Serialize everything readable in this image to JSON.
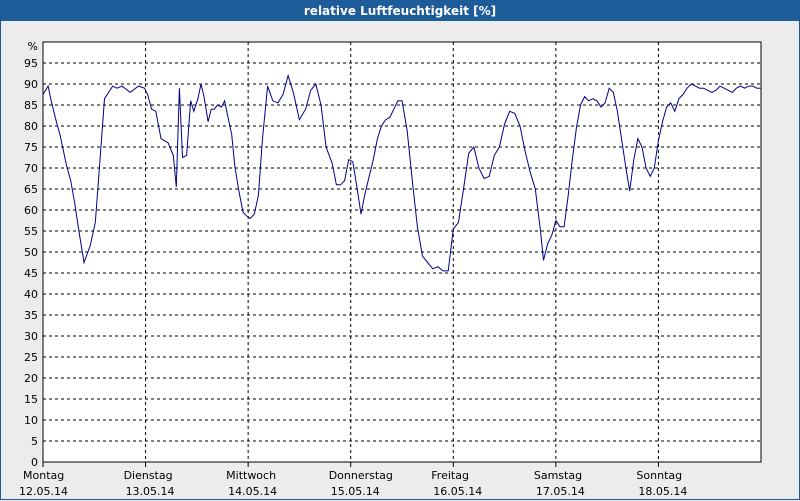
{
  "window": {
    "title": "relative Luftfeuchtigkeit [%]"
  },
  "colors": {
    "titlebar": "#1d5c99",
    "line": "#00008b",
    "grid": "#000000",
    "background": "#ececec"
  },
  "chart_data": {
    "type": "line",
    "title": "relative Luftfeuchtigkeit [%]",
    "ylabel": "%",
    "xlabel": "",
    "ylim": [
      0,
      95
    ],
    "xlim": [
      0,
      7
    ],
    "grid": true,
    "yticks": [
      0,
      5,
      10,
      15,
      20,
      25,
      30,
      35,
      40,
      45,
      50,
      55,
      60,
      65,
      70,
      75,
      80,
      85,
      90,
      95
    ],
    "xticks": [
      {
        "day": "Montag",
        "date": "12.05.14"
      },
      {
        "day": "Dienstag",
        "date": "13.05.14"
      },
      {
        "day": "Mittwoch",
        "date": "14.05.14"
      },
      {
        "day": "Donnerstag",
        "date": "15.05.14"
      },
      {
        "day": "Freitag",
        "date": "16.05.14"
      },
      {
        "day": "Samstag",
        "date": "17.05.14"
      },
      {
        "day": "Sonntag",
        "date": "18.05.14"
      }
    ],
    "series": [
      {
        "x": [
          0.0,
          0.05,
          0.08,
          0.12,
          0.17,
          0.23,
          0.27,
          0.31,
          0.35,
          0.4,
          0.46,
          0.51,
          0.55,
          0.6,
          0.64,
          0.68,
          0.72,
          0.77,
          0.85,
          0.93,
          0.99,
          1.02,
          1.06,
          1.1,
          1.15,
          1.22,
          1.27,
          1.3,
          1.33,
          1.36,
          1.4,
          1.44,
          1.47,
          1.51,
          1.54,
          1.57,
          1.61,
          1.64,
          1.67,
          1.7,
          1.74,
          1.77,
          1.8,
          1.84,
          1.87,
          1.91,
          1.95,
          1.99,
          2.02,
          2.06,
          2.1,
          2.14,
          2.19,
          2.24,
          2.29,
          2.34,
          2.39,
          2.44,
          2.5,
          2.56,
          2.61,
          2.66,
          2.71,
          2.76,
          2.82,
          2.86,
          2.9,
          2.94,
          2.98,
          3.02,
          3.06,
          3.1,
          3.14,
          3.18,
          3.22,
          3.26,
          3.3,
          3.34,
          3.38,
          3.42,
          3.46,
          3.5,
          3.55,
          3.6,
          3.65,
          3.7,
          3.75,
          3.8,
          3.85,
          3.9,
          3.95,
          4.0,
          4.05,
          4.1,
          4.15,
          4.2,
          4.25,
          4.3,
          4.35,
          4.4,
          4.45,
          4.5,
          4.55,
          4.6,
          4.65,
          4.7,
          4.75,
          4.8,
          4.85,
          4.88,
          4.92,
          4.96,
          5.0,
          5.04,
          5.08,
          5.12,
          5.16,
          5.2,
          5.24,
          5.28,
          5.32,
          5.36,
          5.4,
          5.44,
          5.48,
          5.52,
          5.56,
          5.6,
          5.64,
          5.68,
          5.72,
          5.76,
          5.8,
          5.84,
          5.88,
          5.92,
          5.96,
          6.0,
          6.04,
          6.08,
          6.12,
          6.16,
          6.2,
          6.24,
          6.28,
          6.32,
          6.36,
          6.4,
          6.44,
          6.48,
          6.52,
          6.56,
          6.6,
          6.64,
          6.68,
          6.72,
          6.76,
          6.8,
          6.84,
          6.88,
          6.92,
          6.96,
          7.0
        ],
        "values": [
          87.5,
          89.5,
          86.0,
          82.0,
          77.5,
          70.5,
          67.0,
          61.5,
          55.0,
          47.5,
          51.5,
          57.0,
          70.0,
          86.5,
          88.0,
          89.5,
          89.0,
          89.5,
          88.0,
          89.5,
          89.0,
          87.5,
          84.0,
          83.5,
          77.0,
          76.0,
          73.0,
          65.5,
          89.0,
          72.5,
          73.0,
          86.0,
          83.5,
          86.5,
          90.0,
          87.0,
          81.0,
          84.0,
          84.0,
          85.0,
          84.5,
          86.0,
          82.5,
          78.0,
          70.5,
          64.5,
          59.5,
          58.5,
          58.0,
          59.0,
          63.5,
          77.0,
          89.5,
          86.0,
          85.5,
          87.5,
          92.0,
          88.0,
          81.5,
          84.0,
          88.5,
          90.0,
          85.0,
          75.0,
          71.0,
          66.0,
          66.0,
          67.0,
          72.0,
          71.5,
          65.5,
          59.0,
          64.0,
          68.0,
          72.0,
          77.0,
          80.0,
          81.5,
          82.0,
          84.0,
          86.0,
          86.0,
          79.0,
          67.0,
          56.0,
          49.0,
          47.5,
          46.0,
          46.5,
          45.5,
          45.5,
          55.5,
          57.0,
          65.0,
          73.5,
          75.0,
          70.0,
          67.5,
          68.0,
          73.0,
          75.0,
          80.5,
          83.5,
          83.0,
          80.0,
          74.0,
          69.0,
          65.0,
          55.0,
          48.0,
          52.0,
          54.0,
          57.5,
          56.0,
          56.0,
          63.5,
          72.0,
          79.5,
          85.0,
          87.0,
          86.0,
          86.5,
          86.0,
          84.5,
          85.5,
          89.0,
          88.0,
          83.5,
          77.0,
          70.5,
          64.5,
          72.0,
          77.0,
          75.0,
          70.0,
          68.0,
          70.0,
          76.5,
          81.0,
          84.5,
          85.5,
          83.5,
          86.5,
          87.5,
          89.0,
          90.0,
          89.5,
          89.0,
          89.0,
          88.5,
          88.0,
          88.5,
          89.5,
          89.0,
          88.5,
          88.0,
          89.0,
          89.5,
          89.0,
          89.5,
          89.5,
          89.0,
          89.0
        ]
      }
    ]
  }
}
